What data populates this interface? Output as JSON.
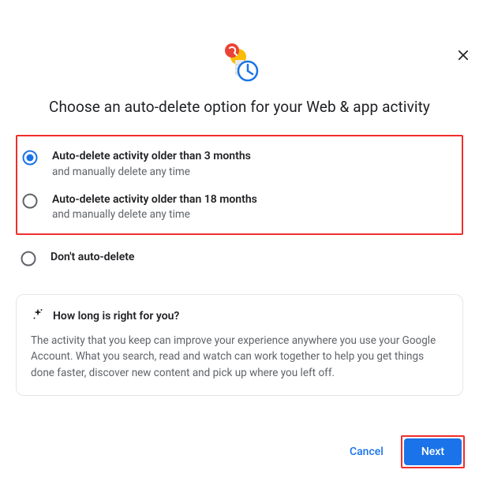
{
  "title": "Choose an auto-delete option for your Web & app activity",
  "options": [
    {
      "title": "Auto-delete activity older than 3 months",
      "subtitle": "and manually delete any time",
      "selected": true
    },
    {
      "title": "Auto-delete activity older than 18 months",
      "subtitle": "and manually delete any time",
      "selected": false
    },
    {
      "title": "Don't auto-delete",
      "subtitle": "",
      "selected": false
    }
  ],
  "info": {
    "title": "How long is right for you?",
    "body": "The activity that you keep can improve your experience anywhere you use your Google Account. What you search, read and watch can work together to help you get things done faster, discover new content and pick up where you left off."
  },
  "buttons": {
    "cancel": "Cancel",
    "next": "Next"
  },
  "icons": {
    "close": "close-icon",
    "hero": "clock-hero-icon",
    "sparkle": "sparkle-icon"
  },
  "colors": {
    "accent": "#1a73e8",
    "highlight": "#ef2f2c"
  }
}
